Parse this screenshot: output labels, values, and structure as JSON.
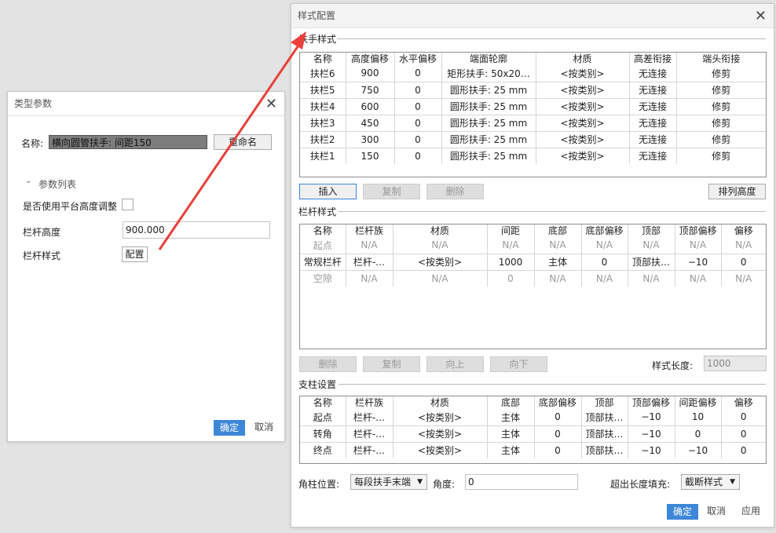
{
  "type_params": {
    "title": "类型参数",
    "name_label": "名称:",
    "name_value": "横向圆管扶手: 间距150",
    "rename_button": "重命名",
    "param_list_label": "参数列表",
    "use_platform_label": "是否使用平台高度调整",
    "railing_height_label": "栏杆高度",
    "railing_height_value": "900.000",
    "railing_style_label": "栏杆样式",
    "config_button": "配置",
    "ok": "确定",
    "cancel": "取消"
  },
  "style_config": {
    "title": "样式配置",
    "handrail": {
      "section_title": "扶手样式",
      "headers": [
        "名称",
        "高度偏移",
        "水平偏移",
        "端面轮廓",
        "材质",
        "高差衔接",
        "端头衔接"
      ],
      "rows": [
        [
          "扶栏6",
          "900",
          "0",
          "矩形扶手: 50x20…",
          "<按类别>",
          "无连接",
          "修剪"
        ],
        [
          "扶栏5",
          "750",
          "0",
          "圆形扶手: 25 mm",
          "<按类别>",
          "无连接",
          "修剪"
        ],
        [
          "扶栏4",
          "600",
          "0",
          "圆形扶手: 25 mm",
          "<按类别>",
          "无连接",
          "修剪"
        ],
        [
          "扶栏3",
          "450",
          "0",
          "圆形扶手: 25 mm",
          "<按类别>",
          "无连接",
          "修剪"
        ],
        [
          "扶栏2",
          "300",
          "0",
          "圆形扶手: 25 mm",
          "<按类别>",
          "无连接",
          "修剪"
        ],
        [
          "扶栏1",
          "150",
          "0",
          "圆形扶手: 25 mm",
          "<按类别>",
          "无连接",
          "修剪"
        ]
      ],
      "buttons": {
        "insert": "插入",
        "copy": "复制",
        "delete": "删除",
        "sort_height": "排列高度"
      }
    },
    "baluster": {
      "section_title": "栏杆样式",
      "headers": [
        "名称",
        "栏杆族",
        "材质",
        "间距",
        "底部",
        "底部偏移",
        "顶部",
        "顶部偏移",
        "偏移"
      ],
      "rows": [
        [
          "起点",
          "N/A",
          "N/A",
          "N/A",
          "N/A",
          "N/A",
          "N/A",
          "N/A",
          "N/A"
        ],
        [
          "常规栏杆",
          "栏杆-…",
          "<按类别>",
          "1000",
          "主体",
          "0",
          "顶部扶…",
          "−10",
          "0"
        ],
        [
          "空隙",
          "N/A",
          "N/A",
          "0",
          "N/A",
          "N/A",
          "N/A",
          "N/A",
          "N/A"
        ]
      ],
      "buttons": {
        "delete": "删除",
        "copy": "复制",
        "up": "向上",
        "down": "向下"
      },
      "style_length_label": "样式长度:",
      "style_length_value": "1000"
    },
    "post": {
      "section_title": "支柱设置",
      "headers": [
        "名称",
        "栏杆族",
        "材质",
        "底部",
        "底部偏移",
        "顶部",
        "顶部偏移",
        "间距偏移",
        "偏移"
      ],
      "rows": [
        [
          "起点",
          "栏杆-…",
          "<按类别>",
          "主体",
          "0",
          "顶部扶…",
          "−10",
          "10",
          "0"
        ],
        [
          "转角",
          "栏杆-…",
          "<按类别>",
          "主体",
          "0",
          "顶部扶…",
          "−10",
          "0",
          "0"
        ],
        [
          "终点",
          "栏杆-…",
          "<按类别>",
          "主体",
          "0",
          "顶部扶…",
          "−10",
          "−10",
          "0"
        ]
      ]
    },
    "corner_post_label": "角柱位置:",
    "corner_post_value": "每段扶手末端",
    "angle_label": "角度:",
    "angle_value": "0",
    "overflow_fill_label": "超出长度填充:",
    "overflow_fill_value": "截断样式",
    "ok": "确定",
    "cancel": "取消",
    "apply": "应用"
  },
  "colors": {
    "primary": "#3d87d8",
    "arrow": "#e8403a"
  }
}
